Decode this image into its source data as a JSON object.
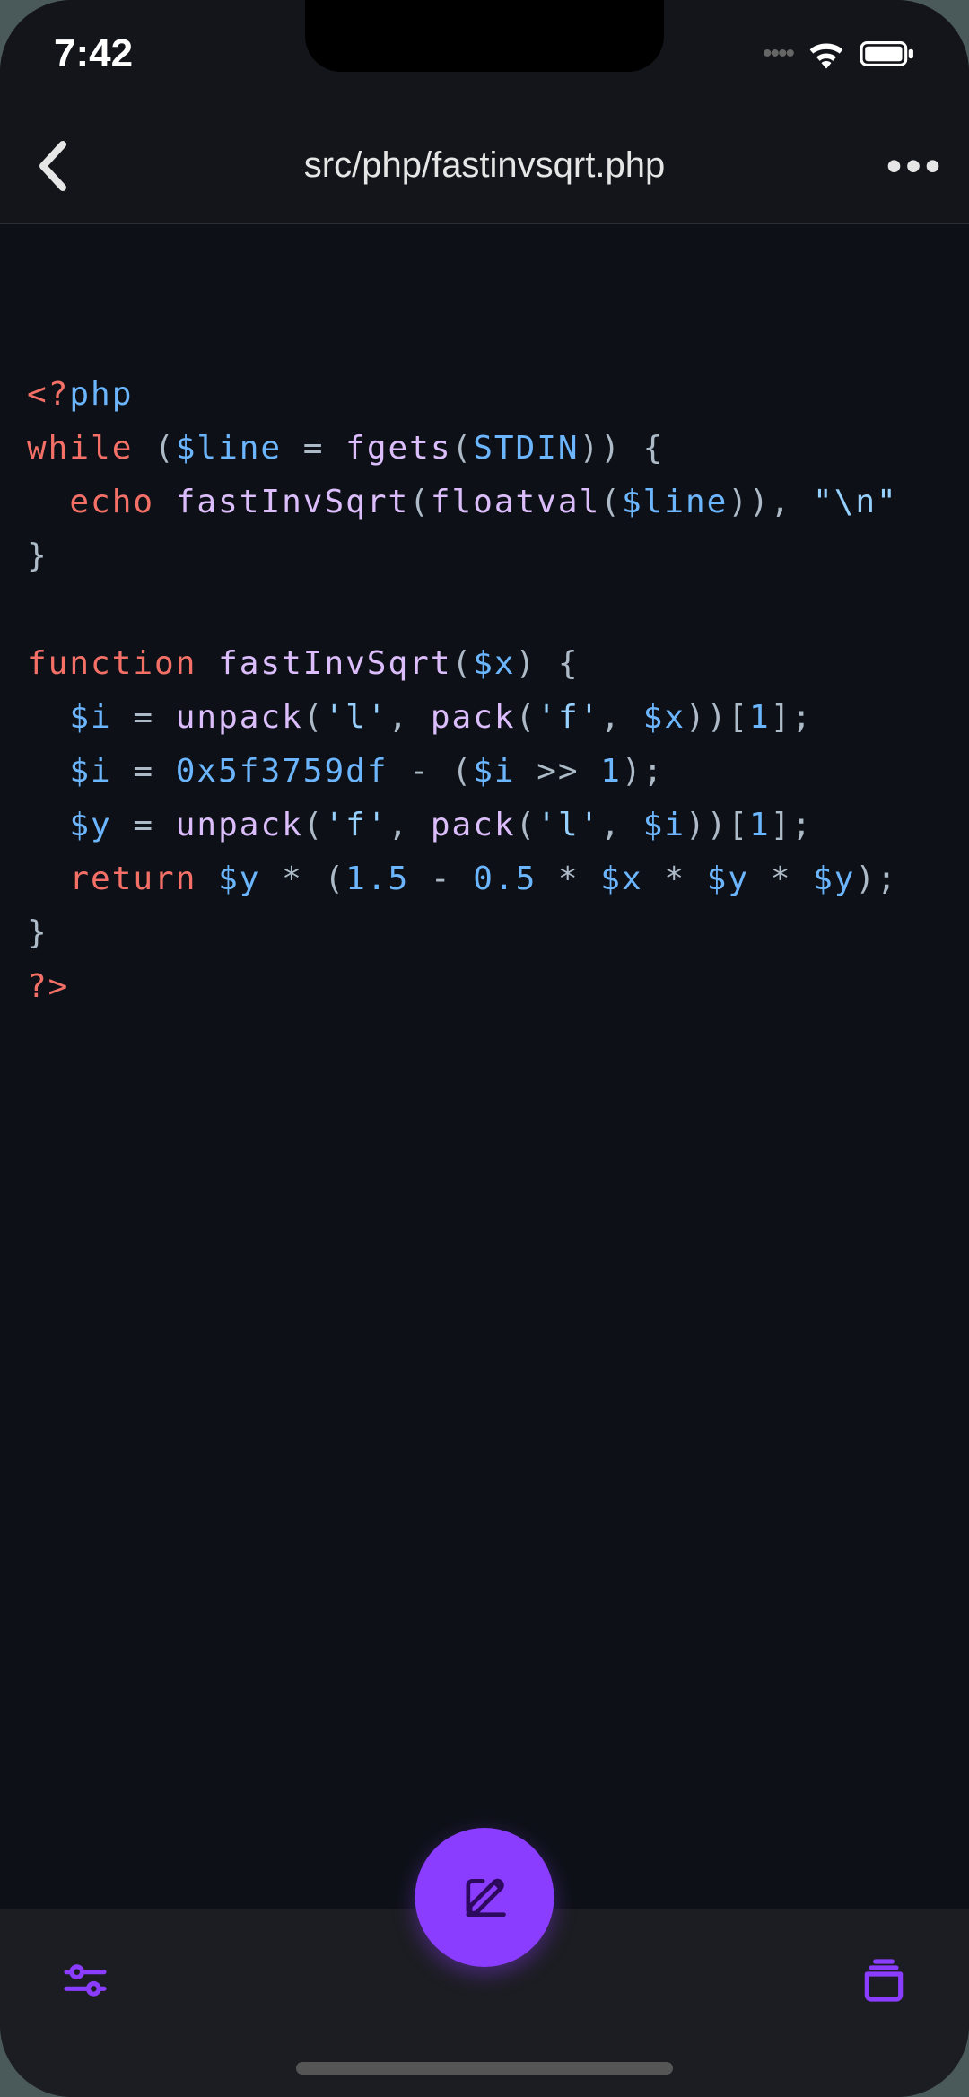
{
  "status": {
    "time": "7:42",
    "dots": "••••"
  },
  "nav": {
    "title": "src/php/fastinvsqrt.php",
    "more": "•••"
  },
  "code": {
    "line1_open": "<?",
    "line1_php": "php",
    "line2_while": "while",
    "line2_paren1": " (",
    "line2_var": "$line",
    "line2_eq": " = ",
    "line2_fgets": "fgets",
    "line2_paren2": "(",
    "line2_stdin": "STDIN",
    "line2_paren3": ")) {",
    "line3_indent": "  ",
    "line3_echo": "echo",
    "line3_sp": " ",
    "line3_fn": "fastInvSqrt",
    "line3_paren1": "(",
    "line3_floatval": "floatval",
    "line3_paren2": "(",
    "line3_var": "$line",
    "line3_paren3": ")), ",
    "line3_str": "\"\\n\"",
    "line4_brace": "}",
    "line6_function": "function",
    "line6_sp": " ",
    "line6_name": "fastInvSqrt",
    "line6_paren1": "(",
    "line6_var": "$x",
    "line6_paren2": ") {",
    "line7_indent": "  ",
    "line7_var": "$i",
    "line7_eq": " = ",
    "line7_unpack": "unpack",
    "line7_paren1": "(",
    "line7_str1": "'l'",
    "line7_comma": ", ",
    "line7_pack": "pack",
    "line7_paren2": "(",
    "line7_str2": "'f'",
    "line7_comma2": ", ",
    "line7_var2": "$x",
    "line7_paren3": "))[",
    "line7_num": "1",
    "line7_paren4": "];",
    "line8_indent": "  ",
    "line8_var": "$i",
    "line8_eq": " = ",
    "line8_hex": "0x5f3759df",
    "line8_minus": " - (",
    "line8_var2": "$i",
    "line8_shift": " >> ",
    "line8_num": "1",
    "line8_paren": ");",
    "line9_indent": "  ",
    "line9_var": "$y",
    "line9_eq": " = ",
    "line9_unpack": "unpack",
    "line9_paren1": "(",
    "line9_str1": "'f'",
    "line9_comma": ", ",
    "line9_pack": "pack",
    "line9_paren2": "(",
    "line9_str2": "'l'",
    "line9_comma2": ", ",
    "line9_var2": "$i",
    "line9_paren3": "))[",
    "line9_num": "1",
    "line9_paren4": "];",
    "line10_indent": "  ",
    "line10_return": "return",
    "line10_sp": " ",
    "line10_var1": "$y",
    "line10_mul1": " * (",
    "line10_num1": "1.5",
    "line10_minus": " - ",
    "line10_num2": "0.5",
    "line10_mul2": " * ",
    "line10_var2": "$x",
    "line10_mul3": " * ",
    "line10_var3": "$y",
    "line10_mul4": " * ",
    "line10_var4": "$y",
    "line10_paren": ");",
    "line11_brace": "}",
    "line12_close": "?>"
  }
}
